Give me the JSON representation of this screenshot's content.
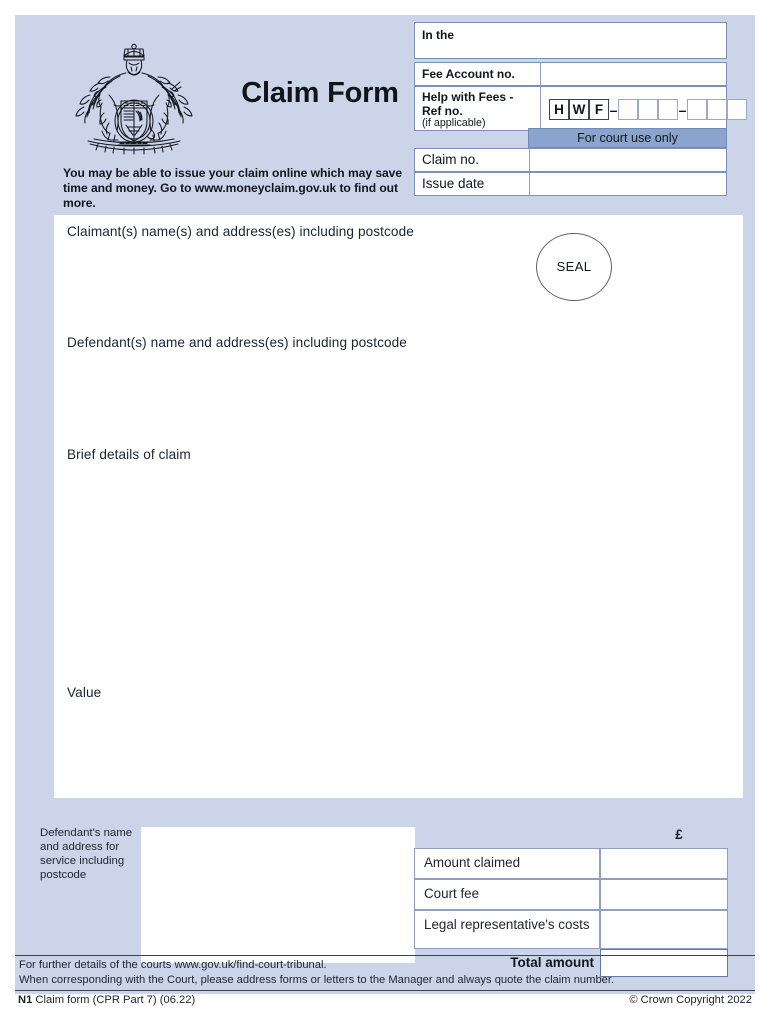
{
  "document": {
    "title": "Claim Form",
    "crest_icon": "royal-coat-of-arms-icon",
    "online_note": "You may be able to issue your claim online which may save time and money. Go to www.moneyclaim.gov.uk to find out more."
  },
  "court_details": {
    "in_the_label": "In the",
    "in_the_value": "",
    "fee_account_label": "Fee Account no.",
    "fee_account_value": "",
    "help_with_fees_label": "Help with Fees -",
    "help_with_fees_label2": "Ref no.",
    "help_with_fees_note": "(if applicable)",
    "hwf_prefix": [
      "H",
      "W",
      "F"
    ],
    "hwf_separator": "–",
    "hwf_group1": [
      "",
      "",
      ""
    ],
    "hwf_group2": [
      "",
      "",
      ""
    ],
    "for_court_use_only": "For court use only",
    "claim_no_label": "Claim no.",
    "claim_no_value": "",
    "issue_date_label": "Issue date",
    "issue_date_value": ""
  },
  "body": {
    "claimant_label": "Claimant(s) name(s) and address(es) including postcode",
    "claimant_value": "",
    "defendant_label": "Defendant(s) name and address(es) including postcode",
    "defendant_value": "",
    "brief_details_label": "Brief details of claim",
    "brief_details_value": "",
    "value_label": "Value",
    "value_value": "",
    "seal_label": "SEAL"
  },
  "service": {
    "address_label": "Defendant's name and address for service including postcode",
    "address_value": ""
  },
  "amounts": {
    "currency_symbol": "£",
    "rows": [
      {
        "label": "Amount claimed",
        "value": ""
      },
      {
        "label": "Court fee",
        "value": ""
      },
      {
        "label": "Legal representative's costs",
        "value": ""
      }
    ],
    "total_label": "Total amount",
    "total_value": ""
  },
  "footer": {
    "line1": "For further details of the courts www.gov.uk/find-court-tribunal.",
    "line2": "When corresponding with the Court, please address forms or letters to the Manager and always quote the claim number.",
    "form_code": "N1",
    "form_desc": "Claim form (CPR Part 7) (06.22)",
    "copyright": "© Crown Copyright 2022"
  },
  "colors": {
    "sheet_tint": "#ccd4ea",
    "court_bar": "#8aa4cd",
    "border": "#7e90b8",
    "text": "#12161c"
  }
}
